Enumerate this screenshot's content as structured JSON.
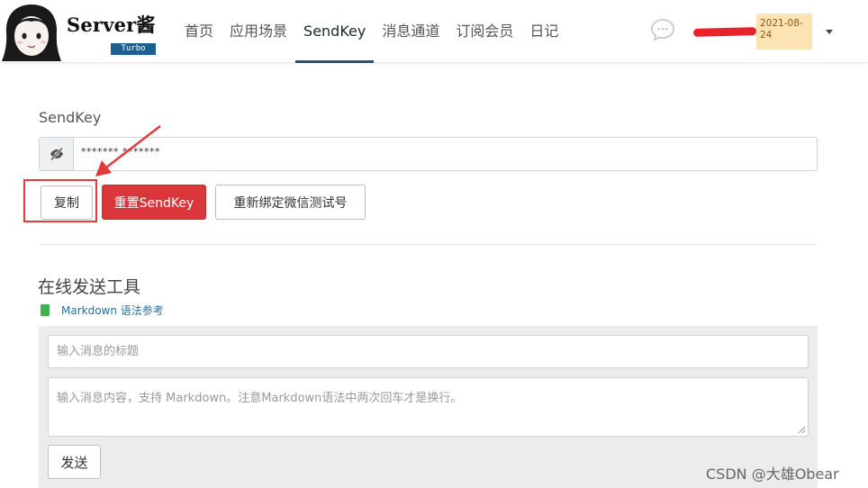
{
  "header": {
    "logo_title": "Server酱",
    "logo_badge": "Turbo",
    "nav": [
      "首页",
      "应用场景",
      "SendKey",
      "消息通道",
      "订阅会员",
      "日记"
    ],
    "active_nav": "SendKey",
    "date_badge_line1": "2021-08-",
    "date_badge_line2": "24",
    "icons": {
      "message": "chat-bubble-icon",
      "dropdown": "caret-down-icon"
    },
    "colors": {
      "nav_active_underline": "#24546f",
      "date_badge_bg": "#fbe3b3",
      "redaction": "#e8242a"
    }
  },
  "sendkey": {
    "label": "SendKey",
    "masked_value": "*******  *******",
    "toggle_icon": "eye-slash-icon",
    "buttons": {
      "copy": "复制",
      "reset": "重置SendKey",
      "rebind": "重新绑定微信测试号"
    },
    "colors": {
      "reset_bg": "#d9373b",
      "highlight_box": "#e33b3b"
    }
  },
  "tool": {
    "title": "在线发送工具",
    "markdown_link": "Markdown 语法参考",
    "title_placeholder": "输入消息的标题",
    "content_placeholder": "输入消息内容，支持 Markdown。注意Markdown语法中两次回车才是换行。",
    "send_button": "发送",
    "colors": {
      "link": "#2a6f9b",
      "book_icon": "#3fb34f",
      "panel_bg": "#ececec"
    }
  },
  "watermark": "CSDN @大雄Obear"
}
